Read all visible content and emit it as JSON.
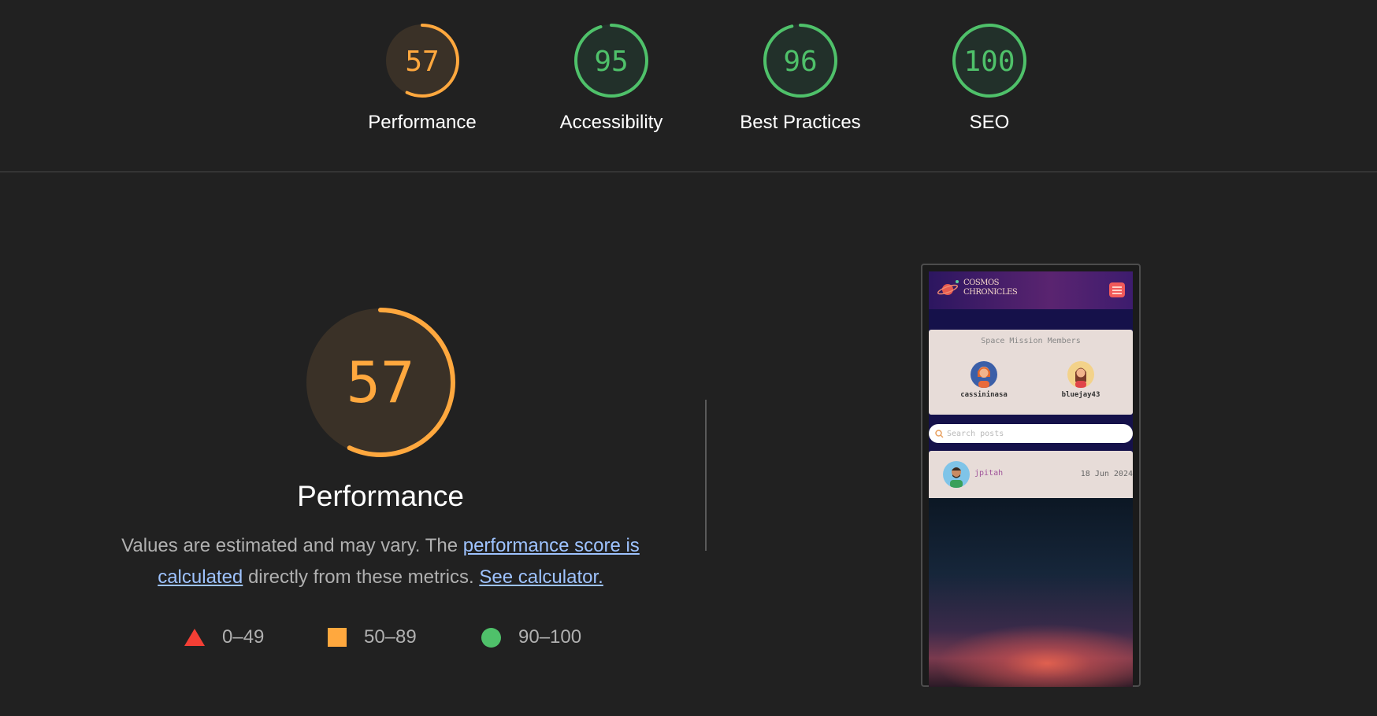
{
  "categories": [
    {
      "score": "57",
      "label": "Performance",
      "fraction": 0.57,
      "status": "average"
    },
    {
      "score": "95",
      "label": "Accessibility",
      "fraction": 0.95,
      "status": "pass"
    },
    {
      "score": "96",
      "label": "Best Practices",
      "fraction": 0.96,
      "status": "pass"
    },
    {
      "score": "100",
      "label": "SEO",
      "fraction": 1.0,
      "status": "pass"
    }
  ],
  "performance": {
    "score": "57",
    "fraction": 0.57,
    "title": "Performance",
    "desc_prefix": "Values are estimated and may vary. The ",
    "link1": "performance score is calculated",
    "desc_middle": " directly from these metrics. ",
    "link2": "See calculator."
  },
  "legend": [
    {
      "range": "0–49",
      "shape": "triangle",
      "color": "#f33f35"
    },
    {
      "range": "50–89",
      "shape": "square",
      "color": "#ffa83e"
    },
    {
      "range": "90–100",
      "shape": "circle",
      "color": "#4fc16a"
    }
  ],
  "colors": {
    "average": "#ffa83e",
    "average_bg": "#3a3127",
    "pass": "#4fc16a",
    "pass_bg": "#22302a"
  },
  "screenshot": {
    "logo_line1": "COSMOS",
    "logo_line2": "CHRONICLES",
    "members_title": "Space Mission Members",
    "members": [
      "cassininasa",
      "bluejay43"
    ],
    "search_placeholder": "Search posts",
    "post_user": "jpitah",
    "post_date": "18 Jun 2024"
  }
}
